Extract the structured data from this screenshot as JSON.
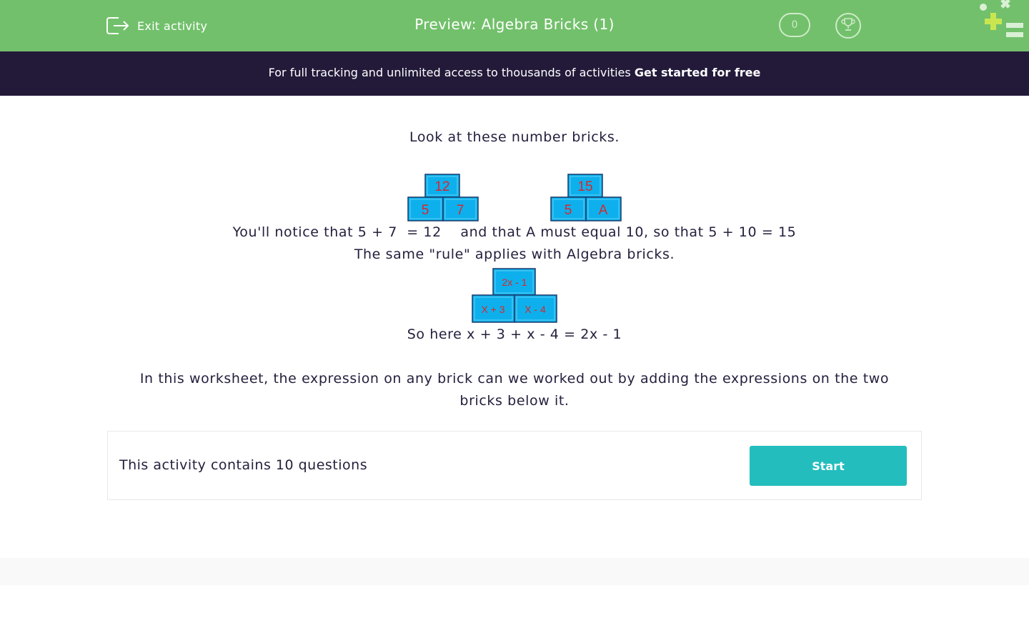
{
  "header": {
    "exit_label": "Exit activity",
    "title": "Preview: Algebra Bricks (1)",
    "score": "0",
    "bar_color": "#72c06b",
    "icons": [
      "exit-icon",
      "trophy-icon",
      "brand-logo-icon"
    ]
  },
  "promo": {
    "text": "For full tracking and unlimited access to thousands of activities ",
    "link": "Get started for free"
  },
  "content": {
    "intro": "Look at these number bricks.",
    "bricks_example_1": {
      "top": "12",
      "left": "5",
      "right": "7"
    },
    "bricks_example_2": {
      "top": "15",
      "left": "5",
      "right": "A"
    },
    "line_notice": "You'll notice that 5 + 7  = 12    and that A must equal 10, so that 5 + 10 = 15",
    "line_rule": "The same \"rule\" applies with Algebra bricks.",
    "bricks_algebra": {
      "top": "2x - 1",
      "left": "X + 3",
      "right": "X - 4"
    },
    "line_so": "So here x + 3 + x - 4 = 2x - 1",
    "worksheet_line1": "In this worksheet, the expression on any brick can we worked out by adding the expressions on the two",
    "worksheet_line2": "bricks below it."
  },
  "activity": {
    "count_text": "This activity contains 10 questions",
    "start_label": "Start",
    "accent_color": "#24bdbd"
  },
  "brick_colors": {
    "fill": "#0db0ec",
    "border": "#1a3a6a",
    "text": "#d9262c"
  }
}
